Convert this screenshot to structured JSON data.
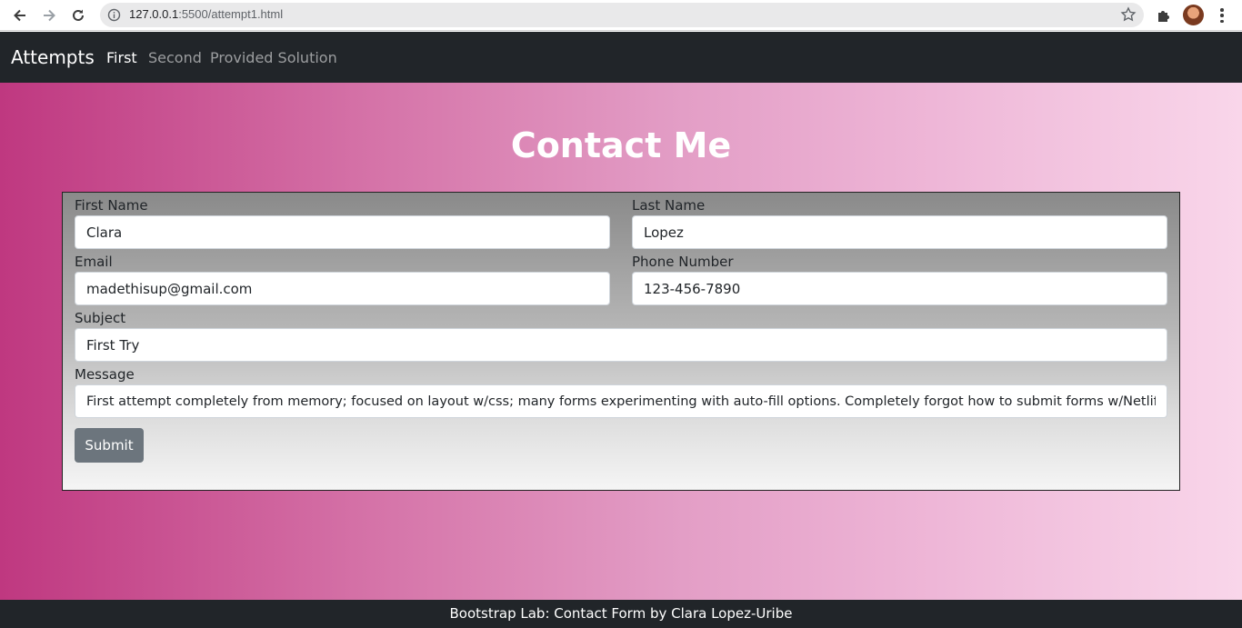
{
  "browser": {
    "url_host": "127.0.0.1",
    "url_rest": ":5500/attempt1.html",
    "icons": [
      "back-icon",
      "forward-icon",
      "reload-icon",
      "info-icon",
      "star-icon",
      "extensions-icon",
      "profile-avatar",
      "menu-icon"
    ]
  },
  "navbar": {
    "brand": "Attempts",
    "links": [
      {
        "label": "First",
        "active": true
      },
      {
        "label": "Second",
        "active": false
      },
      {
        "label": "Provided Solution",
        "active": false
      }
    ]
  },
  "page": {
    "title": "Contact Me",
    "form": {
      "first_name": {
        "label": "First Name",
        "value": "Clara"
      },
      "last_name": {
        "label": "Last Name",
        "value": "Lopez"
      },
      "email": {
        "label": "Email",
        "value": "madethisup@gmail.com"
      },
      "phone": {
        "label": "Phone Number",
        "value": "123-456-7890"
      },
      "subject": {
        "label": "Subject",
        "value": "First Try"
      },
      "message": {
        "label": "Message",
        "value": "First attempt completely from memory; focused on layout w/css; many forms experimenting with auto-fill options. Completely forgot how to submit forms w/Netlify"
      },
      "submit_label": "Submit"
    }
  },
  "footer": {
    "text": "Bootstrap Lab: Contact Form by Clara Lopez-Uribe"
  },
  "colors": {
    "navbar_bg": "#212529",
    "gradient_start": "#bf3880",
    "gradient_end": "#f9d6ea",
    "submit_bg": "#6c757d"
  }
}
